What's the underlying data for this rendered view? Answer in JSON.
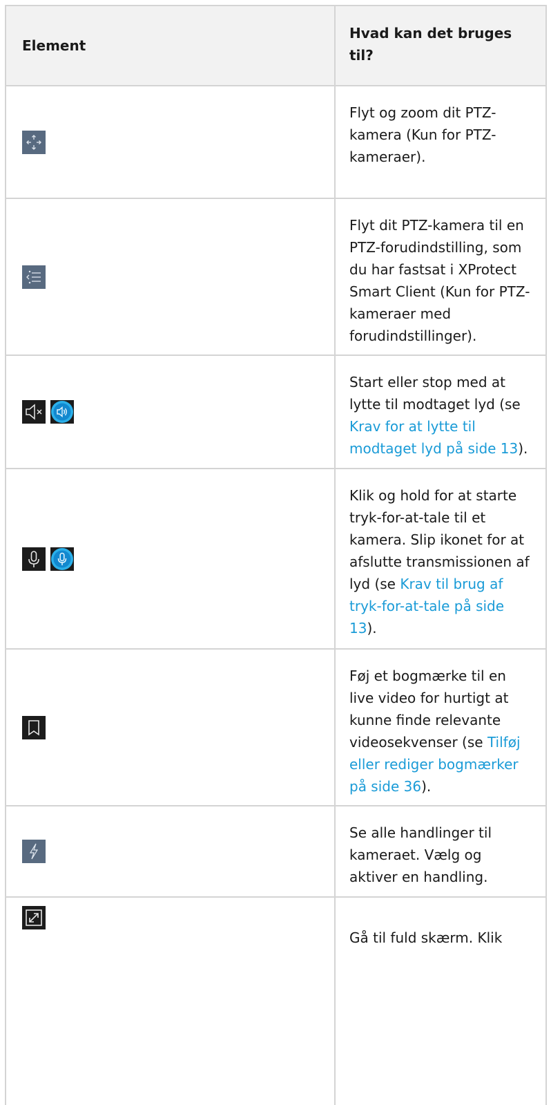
{
  "table": {
    "headers": {
      "element": "Element",
      "usage": "Hvad kan det bruges til?"
    },
    "rows": [
      {
        "icons": [
          "ptz-move-icon"
        ],
        "text": "Flyt og zoom dit PTZ-kamera (Kun for PTZ-kameraer)."
      },
      {
        "icons": [
          "ptz-preset-list-icon"
        ],
        "text": "Flyt dit PTZ-kamera til en PTZ-forudindstilling, som du har fastsat i XProtect Smart Client (Kun for PTZ-kameraer med forudindstillinger)."
      },
      {
        "icons": [
          "speaker-muted-icon",
          "speaker-active-icon"
        ],
        "text_before": "Start eller stop med at lytte til modtaget lyd (se ",
        "link": "Krav for at lytte til modtaget lyd på side 13",
        "text_after": ")."
      },
      {
        "icons": [
          "microphone-icon",
          "microphone-active-icon"
        ],
        "text_before": "Klik og hold for at starte tryk-for-at-tale til et kamera. Slip ikonet for at afslutte transmissionen af lyd (se ",
        "link": "Krav til brug af tryk-for-at-tale på side 13",
        "text_after": ")."
      },
      {
        "icons": [
          "bookmark-icon"
        ],
        "text_before": "Føj et bogmærke til en live video for hurtigt at kunne finde relevante videosekvenser (se ",
        "link": "Tilføj eller rediger bogmærker på side 36",
        "text_after": ")."
      },
      {
        "icons": [
          "lightning-action-icon"
        ],
        "text": "Se alle handlinger til kameraet. Vælg og aktiver en handling."
      },
      {
        "icons": [
          "fullscreen-icon"
        ],
        "text": "Gå til fuld skærm. Klik"
      }
    ]
  }
}
